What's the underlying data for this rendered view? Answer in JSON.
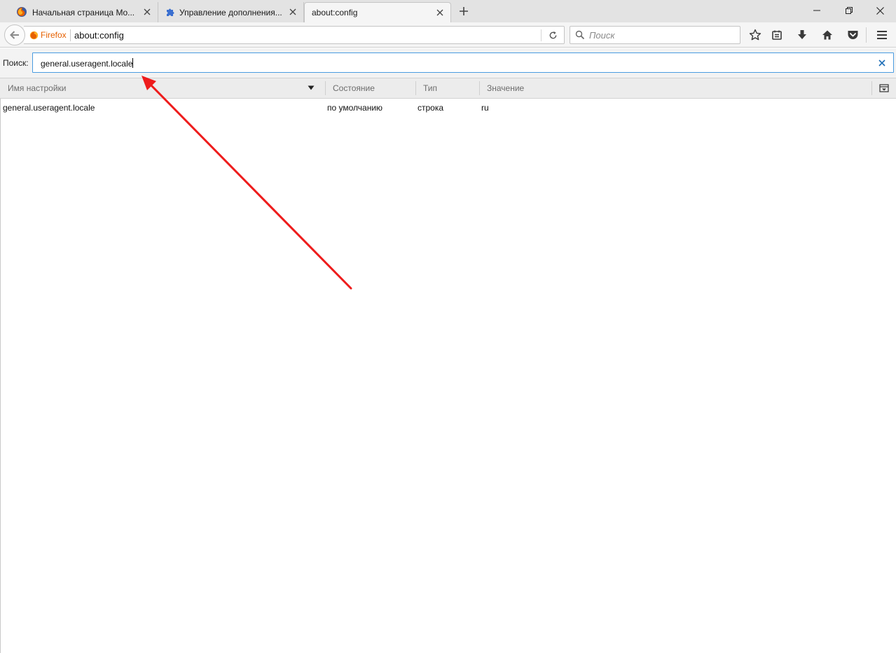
{
  "tabs": [
    {
      "label": "Начальная страница Mo...",
      "favicon": "firefox-logo-icon",
      "active": false
    },
    {
      "label": "Управление дополнения...",
      "favicon": "puzzle-piece-icon",
      "active": false
    },
    {
      "label": "about:config",
      "favicon": "",
      "active": true
    }
  ],
  "navbar": {
    "identity_label": "Firefox",
    "url": "about:config",
    "search_placeholder": "Поиск"
  },
  "config": {
    "search_label": "Поиск:",
    "search_value": "general.useragent.locale",
    "columns": {
      "name": "Имя настройки",
      "status": "Состояние",
      "type": "Тип",
      "value": "Значение"
    },
    "rows": [
      {
        "name": "general.useragent.locale",
        "status": "по умолчанию",
        "type": "строка",
        "value": "ru"
      }
    ]
  },
  "colors": {
    "accent_focus": "#4a9be0",
    "annotation_arrow": "#ee1c1c",
    "firefox_orange": "#e66000"
  }
}
